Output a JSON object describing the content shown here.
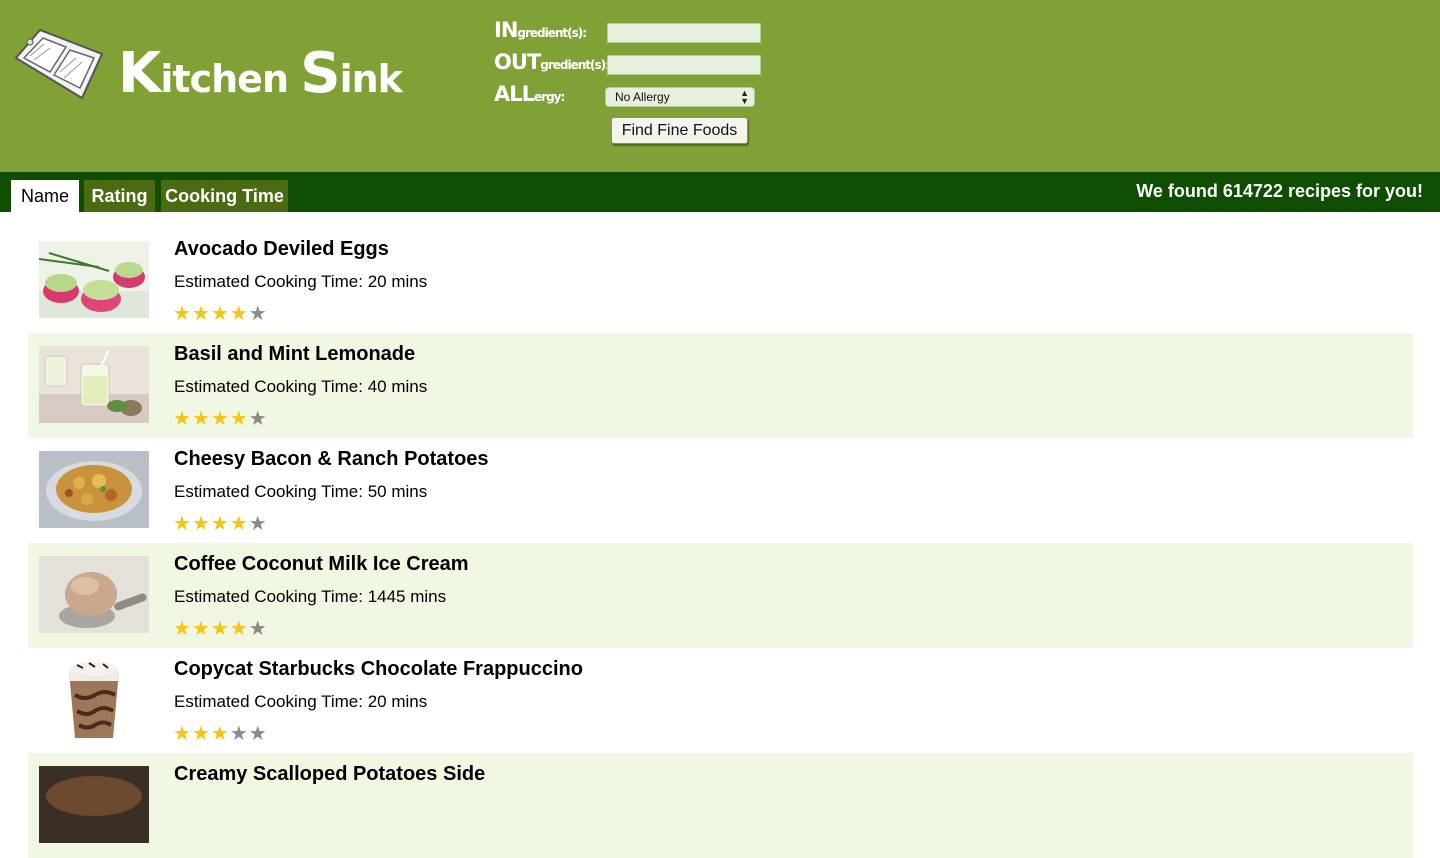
{
  "brand": {
    "letter_k": "K",
    "rest_k": "itchen ",
    "letter_s": "S",
    "rest_s": "ink"
  },
  "form": {
    "in_big": "IN",
    "in_small": "gredient(s):",
    "out_big": "OUT",
    "out_small": "gredient(s):",
    "all_big": "ALL",
    "all_small": "ergy:",
    "ingredient_value": "",
    "outgredient_value": "",
    "allergy_selected": "No Allergy",
    "find_button": "Find Fine Foods"
  },
  "tabs": [
    {
      "label": "Name",
      "active": true
    },
    {
      "label": "Rating",
      "active": false
    },
    {
      "label": "Cooking Time",
      "active": false
    }
  ],
  "found_text": "We found 614722 recipes for you!",
  "recipes": [
    {
      "title": "Avocado Deviled Eggs",
      "cook_time": "Estimated Cooking Time: 20 mins",
      "rating": 4
    },
    {
      "title": "Basil and Mint Lemonade",
      "cook_time": "Estimated Cooking Time: 40 mins",
      "rating": 4
    },
    {
      "title": "Cheesy Bacon & Ranch Potatoes",
      "cook_time": "Estimated Cooking Time: 50 mins",
      "rating": 4
    },
    {
      "title": "Coffee Coconut Milk Ice Cream",
      "cook_time": "Estimated Cooking Time: 1445 mins",
      "rating": 4
    },
    {
      "title": "Copycat Starbucks Chocolate Frappuccino",
      "cook_time": "Estimated Cooking Time: 20 mins",
      "rating": 3
    },
    {
      "title": "Creamy Scalloped Potatoes Side",
      "cook_time": "",
      "rating": 0
    }
  ],
  "colors": {
    "header": "#7fa136",
    "nav": "#0f4d00",
    "tab": "#4a6b0f",
    "row_alt": "#f0f8e3",
    "star_on": "#f6c514",
    "star_off": "#8a8a8a"
  }
}
